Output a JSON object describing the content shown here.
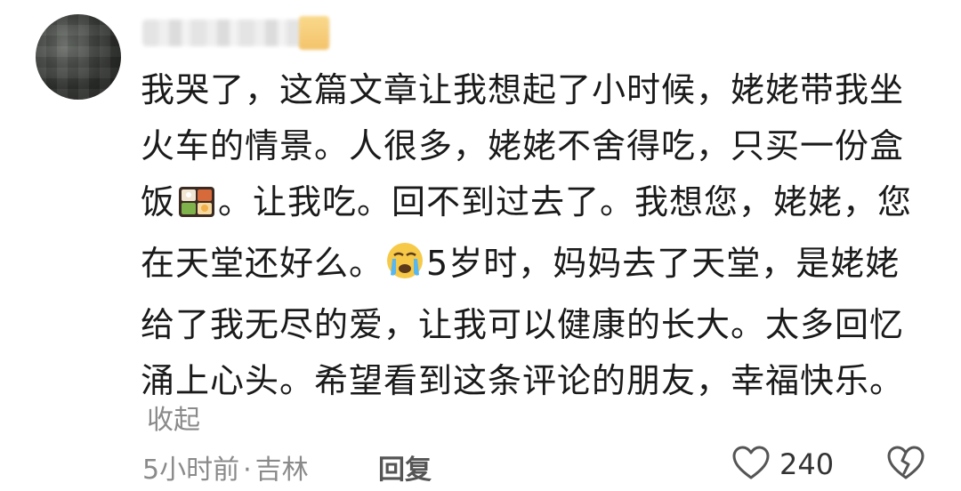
{
  "comment": {
    "lines": [
      "我哭了，这篇文章让我想起了小时候，姥姥带我坐",
      "火车的情景。人很多，姥姥不舍得吃，只买一份盒",
      "饭",
      "。让我吃。回不到过去了。我想您，姥姥，您",
      "在天堂还好么。",
      "5岁时，妈妈去了天堂，是姥姥",
      "给了我无尽的爱，让我可以健康的长大。太多回忆",
      "涌上心头。希望看到这条评论的朋友，幸福快乐。"
    ],
    "emojis": [
      "bento-emoji",
      "crying-emoji"
    ]
  },
  "collapse_label": "收起",
  "meta": {
    "time": "5小时前",
    "separator": "·",
    "location": "吉林"
  },
  "reply_label": "回复",
  "like_count": "240",
  "colors": {
    "text": "#1a1a1a",
    "muted": "#8a8a8a",
    "reply": "#555555"
  }
}
